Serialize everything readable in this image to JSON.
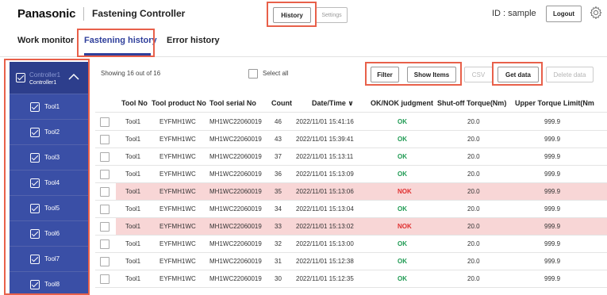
{
  "header": {
    "brand": "Panasonic",
    "app_title": "Fastening Controller",
    "history_label": "History",
    "settings_label": "Settings",
    "user_id": "ID : sample",
    "logout_label": "Logout"
  },
  "tabs": [
    {
      "label": "Work monitor"
    },
    {
      "label": "Fastening history"
    },
    {
      "label": "Error history"
    }
  ],
  "sidebar": {
    "controller_name": "Controller1",
    "controller_sub": "Controller1",
    "tools": [
      "Tool1",
      "Tool2",
      "Tool3",
      "Tool4",
      "Tool5",
      "Tool6",
      "Tool7",
      "Tool8"
    ]
  },
  "toolbar": {
    "showing": "Showing 16 out of 16",
    "select_all": "Select all",
    "filter": "Filter",
    "show_items": "Show Items",
    "csv": "CSV",
    "get_data": "Get data",
    "delete_data": "Delete data"
  },
  "table": {
    "headers": [
      "Tool No",
      "Tool product No",
      "Tool serial No",
      "Count",
      "Date/Time ∨",
      "OK/NOK judgment",
      "Shut-off Torque(Nm)",
      "Upper Torque Limit(Nm"
    ],
    "rows": [
      {
        "tool": "Tool1",
        "product": "EYFMH1WC",
        "serial": "MH1WC22060019",
        "count": "46",
        "datetime": "2022/11/01 15:41:16",
        "judgment": "OK",
        "torque": "20.0",
        "upper": "999.9"
      },
      {
        "tool": "Tool1",
        "product": "EYFMH1WC",
        "serial": "MH1WC22060019",
        "count": "43",
        "datetime": "2022/11/01 15:39:41",
        "judgment": "OK",
        "torque": "20.0",
        "upper": "999.9"
      },
      {
        "tool": "Tool1",
        "product": "EYFMH1WC",
        "serial": "MH1WC22060019",
        "count": "37",
        "datetime": "2022/11/01 15:13:11",
        "judgment": "OK",
        "torque": "20.0",
        "upper": "999.9"
      },
      {
        "tool": "Tool1",
        "product": "EYFMH1WC",
        "serial": "MH1WC22060019",
        "count": "36",
        "datetime": "2022/11/01 15:13:09",
        "judgment": "OK",
        "torque": "20.0",
        "upper": "999.9"
      },
      {
        "tool": "Tool1",
        "product": "EYFMH1WC",
        "serial": "MH1WC22060019",
        "count": "35",
        "datetime": "2022/11/01 15:13:06",
        "judgment": "NOK",
        "torque": "20.0",
        "upper": "999.9"
      },
      {
        "tool": "Tool1",
        "product": "EYFMH1WC",
        "serial": "MH1WC22060019",
        "count": "34",
        "datetime": "2022/11/01 15:13:04",
        "judgment": "OK",
        "torque": "20.0",
        "upper": "999.9"
      },
      {
        "tool": "Tool1",
        "product": "EYFMH1WC",
        "serial": "MH1WC22060019",
        "count": "33",
        "datetime": "2022/11/01 15:13:02",
        "judgment": "NOK",
        "torque": "20.0",
        "upper": "999.9"
      },
      {
        "tool": "Tool1",
        "product": "EYFMH1WC",
        "serial": "MH1WC22060019",
        "count": "32",
        "datetime": "2022/11/01 15:13:00",
        "judgment": "OK",
        "torque": "20.0",
        "upper": "999.9"
      },
      {
        "tool": "Tool1",
        "product": "EYFMH1WC",
        "serial": "MH1WC22060019",
        "count": "31",
        "datetime": "2022/11/01 15:12:38",
        "judgment": "OK",
        "torque": "20.0",
        "upper": "999.9"
      },
      {
        "tool": "Tool1",
        "product": "EYFMH1WC",
        "serial": "MH1WC22060019",
        "count": "30",
        "datetime": "2022/11/01 15:12:35",
        "judgment": "OK",
        "torque": "20.0",
        "upper": "999.9"
      }
    ]
  },
  "colors": {
    "accent": "#2f3f9b",
    "sidebar": "#3a4fa6",
    "highlight": "#e8604a",
    "ok": "#1e9a52",
    "nok": "#e03030",
    "nok_row": "#f8d6d6"
  }
}
